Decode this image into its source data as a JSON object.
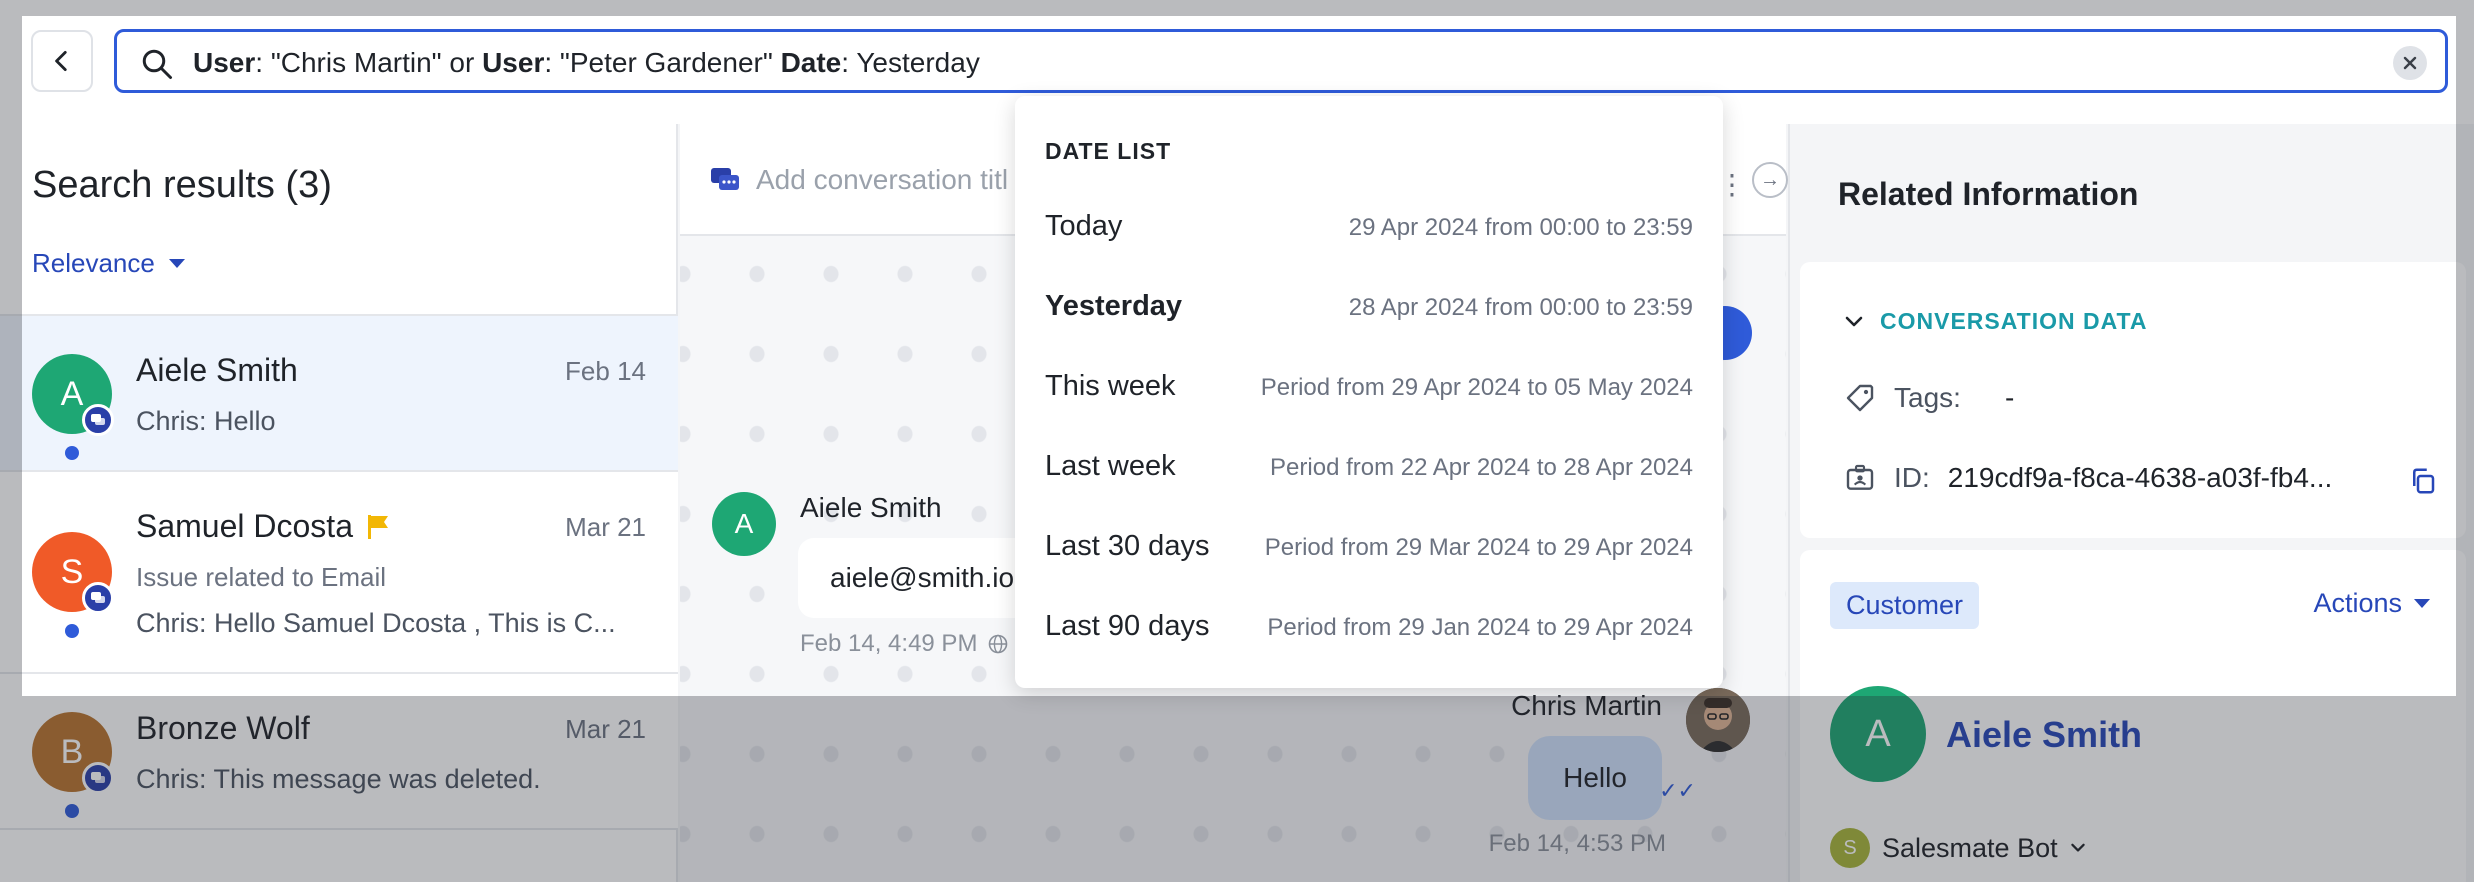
{
  "search": {
    "tokens": [
      {
        "key": "User",
        "value": ": \"Chris Martin\" or "
      },
      {
        "key": "User",
        "value": ": \"Peter Gardener\" "
      },
      {
        "key": "Date",
        "value": ": Yesterday"
      }
    ]
  },
  "results": {
    "title": "Search results (3)",
    "sort_label": "Relevance",
    "items": [
      {
        "initial": "A",
        "avatar_color": "#1ea774",
        "name": "Aiele Smith",
        "date": "Feb 14",
        "subject": "",
        "preview": "Chris: Hello",
        "flagged": false,
        "selected": true
      },
      {
        "initial": "S",
        "avatar_color": "#f05a28",
        "name": "Samuel Dcosta",
        "date": "Mar 21",
        "subject": "Issue related to Email",
        "preview": "Chris: Hello Samuel Dcosta , This is C...",
        "flagged": true,
        "selected": false
      },
      {
        "initial": "B",
        "avatar_color": "#b8742e",
        "name": "Bronze Wolf",
        "date": "Mar 21",
        "subject": "",
        "preview": "Chris: This message was deleted.",
        "flagged": false,
        "selected": false
      }
    ]
  },
  "conversation": {
    "title_placeholder": "Add conversation titl",
    "incoming": {
      "initial": "A",
      "sender": "Aiele Smith",
      "text": "aiele@smith.io",
      "time": "Feb 14, 4:49 PM"
    },
    "outgoing": {
      "sender": "Chris Martin",
      "text": "Hello",
      "time": "Feb 14, 4:53 PM"
    }
  },
  "date_list": {
    "title": "DATE LIST",
    "options": [
      {
        "label": "Today",
        "range": "29 Apr 2024 from 00:00 to 23:59",
        "active": false
      },
      {
        "label": "Yesterday",
        "range": "28 Apr 2024 from 00:00 to 23:59",
        "active": true
      },
      {
        "label": "This week",
        "range": "Period from 29 Apr 2024 to 05 May 2024",
        "active": false
      },
      {
        "label": "Last week",
        "range": "Period from 22 Apr 2024 to 28 Apr 2024",
        "active": false
      },
      {
        "label": "Last 30 days",
        "range": "Period from 29 Mar 2024 to 29 Apr 2024",
        "active": false
      },
      {
        "label": "Last 90 days",
        "range": "Period from 29 Jan 2024 to 29 Apr 2024",
        "active": false
      }
    ]
  },
  "related": {
    "title": "Related Information",
    "section": "CONVERSATION DATA",
    "tags_label": "Tags:",
    "tags_value": "-",
    "id_label": "ID:",
    "id_value": "219cdf9a-f8ca-4638-a03f-fb4...",
    "badge": "Customer",
    "actions_label": "Actions",
    "contact_initial": "A",
    "contact_name": "Aiele Smith",
    "owner_initial": "S",
    "owner_name": "Salesmate Bot"
  },
  "colors": {
    "accent": "#2f5bd9",
    "link": "#2747b8",
    "teal": "#1a9aa8"
  }
}
